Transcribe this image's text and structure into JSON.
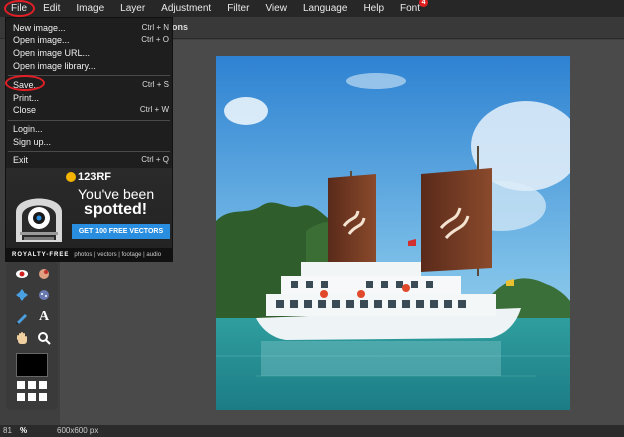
{
  "menubar": {
    "items": [
      {
        "label": "File"
      },
      {
        "label": "Edit"
      },
      {
        "label": "Image"
      },
      {
        "label": "Layer"
      },
      {
        "label": "Adjustment"
      },
      {
        "label": "Filter"
      },
      {
        "label": "View"
      },
      {
        "label": "Language"
      },
      {
        "label": "Help"
      },
      {
        "label": "Font",
        "badge": "4"
      }
    ]
  },
  "optionsbar": {
    "hint": "tool has no additional options",
    "hint_visible_suffix": "ons"
  },
  "file_menu": {
    "items": [
      {
        "label": "New image...",
        "shortcut": "Ctrl + N"
      },
      {
        "label": "Open image...",
        "shortcut": "Ctrl + O"
      },
      {
        "label": "Open image URL...",
        "shortcut": ""
      },
      {
        "label": "Open image library...",
        "shortcut": ""
      },
      {
        "label": "Save...",
        "shortcut": "Ctrl + S"
      },
      {
        "label": "Print...",
        "shortcut": ""
      },
      {
        "label": "Close",
        "shortcut": "Ctrl + W"
      },
      {
        "label": "Login...",
        "shortcut": ""
      },
      {
        "label": "Sign up...",
        "shortcut": ""
      },
      {
        "label": "Exit",
        "shortcut": "Ctrl + Q"
      }
    ]
  },
  "ad": {
    "brand": "123RF",
    "line1": "You've been",
    "line2": "spotted!",
    "cta": "GET 100 FREE VECTORS",
    "footer_bold": "ROYALTY-FREE",
    "footer_rest": "photos | vectors | footage | audio"
  },
  "tools": {
    "text_tool_glyph": "A"
  },
  "status": {
    "zoom": "81",
    "zoom_unit": "%",
    "dimensions": "600x600 px"
  },
  "colors": {
    "menubar_bg": "#272727",
    "dropdown_bg": "#1e1e1e",
    "highlight_circle": "#e21f26",
    "ad_button": "#2a8ee0",
    "foreground_swatch": "#000000"
  }
}
